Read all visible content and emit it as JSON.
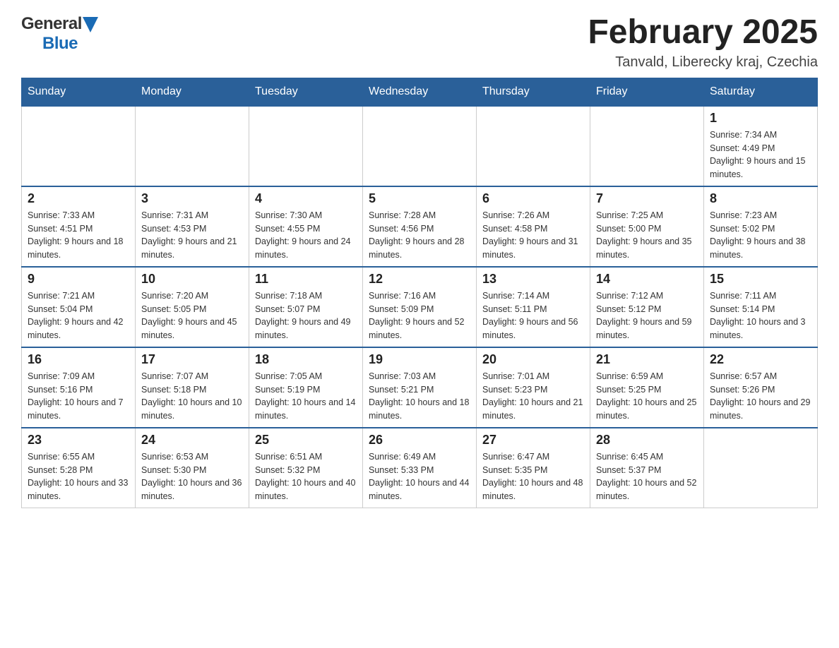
{
  "header": {
    "logo_general": "General",
    "logo_blue": "Blue",
    "month_title": "February 2025",
    "location": "Tanvald, Liberecky kraj, Czechia"
  },
  "weekdays": [
    "Sunday",
    "Monday",
    "Tuesday",
    "Wednesday",
    "Thursday",
    "Friday",
    "Saturday"
  ],
  "weeks": [
    [
      {
        "day": "",
        "info": ""
      },
      {
        "day": "",
        "info": ""
      },
      {
        "day": "",
        "info": ""
      },
      {
        "day": "",
        "info": ""
      },
      {
        "day": "",
        "info": ""
      },
      {
        "day": "",
        "info": ""
      },
      {
        "day": "1",
        "info": "Sunrise: 7:34 AM\nSunset: 4:49 PM\nDaylight: 9 hours and 15 minutes."
      }
    ],
    [
      {
        "day": "2",
        "info": "Sunrise: 7:33 AM\nSunset: 4:51 PM\nDaylight: 9 hours and 18 minutes."
      },
      {
        "day": "3",
        "info": "Sunrise: 7:31 AM\nSunset: 4:53 PM\nDaylight: 9 hours and 21 minutes."
      },
      {
        "day": "4",
        "info": "Sunrise: 7:30 AM\nSunset: 4:55 PM\nDaylight: 9 hours and 24 minutes."
      },
      {
        "day": "5",
        "info": "Sunrise: 7:28 AM\nSunset: 4:56 PM\nDaylight: 9 hours and 28 minutes."
      },
      {
        "day": "6",
        "info": "Sunrise: 7:26 AM\nSunset: 4:58 PM\nDaylight: 9 hours and 31 minutes."
      },
      {
        "day": "7",
        "info": "Sunrise: 7:25 AM\nSunset: 5:00 PM\nDaylight: 9 hours and 35 minutes."
      },
      {
        "day": "8",
        "info": "Sunrise: 7:23 AM\nSunset: 5:02 PM\nDaylight: 9 hours and 38 minutes."
      }
    ],
    [
      {
        "day": "9",
        "info": "Sunrise: 7:21 AM\nSunset: 5:04 PM\nDaylight: 9 hours and 42 minutes."
      },
      {
        "day": "10",
        "info": "Sunrise: 7:20 AM\nSunset: 5:05 PM\nDaylight: 9 hours and 45 minutes."
      },
      {
        "day": "11",
        "info": "Sunrise: 7:18 AM\nSunset: 5:07 PM\nDaylight: 9 hours and 49 minutes."
      },
      {
        "day": "12",
        "info": "Sunrise: 7:16 AM\nSunset: 5:09 PM\nDaylight: 9 hours and 52 minutes."
      },
      {
        "day": "13",
        "info": "Sunrise: 7:14 AM\nSunset: 5:11 PM\nDaylight: 9 hours and 56 minutes."
      },
      {
        "day": "14",
        "info": "Sunrise: 7:12 AM\nSunset: 5:12 PM\nDaylight: 9 hours and 59 minutes."
      },
      {
        "day": "15",
        "info": "Sunrise: 7:11 AM\nSunset: 5:14 PM\nDaylight: 10 hours and 3 minutes."
      }
    ],
    [
      {
        "day": "16",
        "info": "Sunrise: 7:09 AM\nSunset: 5:16 PM\nDaylight: 10 hours and 7 minutes."
      },
      {
        "day": "17",
        "info": "Sunrise: 7:07 AM\nSunset: 5:18 PM\nDaylight: 10 hours and 10 minutes."
      },
      {
        "day": "18",
        "info": "Sunrise: 7:05 AM\nSunset: 5:19 PM\nDaylight: 10 hours and 14 minutes."
      },
      {
        "day": "19",
        "info": "Sunrise: 7:03 AM\nSunset: 5:21 PM\nDaylight: 10 hours and 18 minutes."
      },
      {
        "day": "20",
        "info": "Sunrise: 7:01 AM\nSunset: 5:23 PM\nDaylight: 10 hours and 21 minutes."
      },
      {
        "day": "21",
        "info": "Sunrise: 6:59 AM\nSunset: 5:25 PM\nDaylight: 10 hours and 25 minutes."
      },
      {
        "day": "22",
        "info": "Sunrise: 6:57 AM\nSunset: 5:26 PM\nDaylight: 10 hours and 29 minutes."
      }
    ],
    [
      {
        "day": "23",
        "info": "Sunrise: 6:55 AM\nSunset: 5:28 PM\nDaylight: 10 hours and 33 minutes."
      },
      {
        "day": "24",
        "info": "Sunrise: 6:53 AM\nSunset: 5:30 PM\nDaylight: 10 hours and 36 minutes."
      },
      {
        "day": "25",
        "info": "Sunrise: 6:51 AM\nSunset: 5:32 PM\nDaylight: 10 hours and 40 minutes."
      },
      {
        "day": "26",
        "info": "Sunrise: 6:49 AM\nSunset: 5:33 PM\nDaylight: 10 hours and 44 minutes."
      },
      {
        "day": "27",
        "info": "Sunrise: 6:47 AM\nSunset: 5:35 PM\nDaylight: 10 hours and 48 minutes."
      },
      {
        "day": "28",
        "info": "Sunrise: 6:45 AM\nSunset: 5:37 PM\nDaylight: 10 hours and 52 minutes."
      },
      {
        "day": "",
        "info": ""
      }
    ]
  ]
}
